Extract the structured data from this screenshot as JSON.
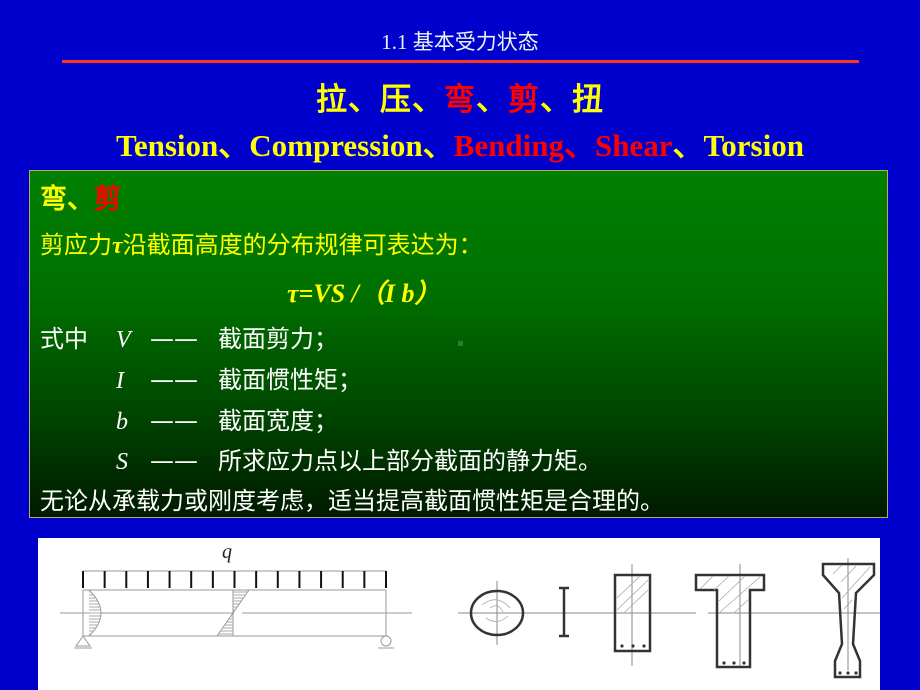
{
  "header": {
    "section_title": "1.1  基本受力状态",
    "title_cn": [
      {
        "text": "拉",
        "color": "#FFFF00"
      },
      {
        "text": "、",
        "color": "#FFFF00"
      },
      {
        "text": "压",
        "color": "#FFFF00"
      },
      {
        "text": "、",
        "color": "#FFFF00"
      },
      {
        "text": "弯",
        "color": "#FF0000"
      },
      {
        "text": "、",
        "color": "#FFFF00"
      },
      {
        "text": "剪",
        "color": "#FF0000"
      },
      {
        "text": "、",
        "color": "#FFFF00"
      },
      {
        "text": "扭",
        "color": "#FFFF00"
      }
    ],
    "title_en": {
      "tension": "Tension",
      "sep1": "、",
      "compression": "Compression",
      "sep2": "、",
      "bending": "Bending",
      "sep3": "、",
      "shear": "Shear",
      "sep4": "、",
      "torsion": "Torsion"
    }
  },
  "content": {
    "subtitle_a": "弯",
    "subtitle_sep": "、",
    "subtitle_b": "剪",
    "intro_pre": "剪应力",
    "intro_tau": "τ",
    "intro_post": "沿截面高度的分布规律可表达为：",
    "formula": "τ=VS /（I b）",
    "where_label": "式中",
    "definitions": [
      {
        "symbol": "V",
        "dash": "——",
        "meaning": "截面剪力；"
      },
      {
        "symbol": "I",
        "dash": "——",
        "meaning": "截面惯性矩；"
      },
      {
        "symbol": "b",
        "dash": "——",
        "meaning": "截面宽度；"
      },
      {
        "symbol": "S",
        "dash": "——",
        "meaning": "所求应力点以上部分截面的静力矩。"
      }
    ],
    "conclusion": "无论从承载力或刚度考虑，适当提高截面惯性矩是合理的。"
  },
  "diagram": {
    "load_label": "q",
    "load_arrow_count": 15,
    "sections": [
      "circle",
      "i-beam-symbol",
      "rectangle",
      "t-section",
      "i-section"
    ]
  },
  "colors": {
    "background": "#0000CC",
    "accent_yellow": "#FFFF00",
    "accent_red": "#FF0000",
    "rule": "#FF3322",
    "panel_green": "#008000"
  }
}
